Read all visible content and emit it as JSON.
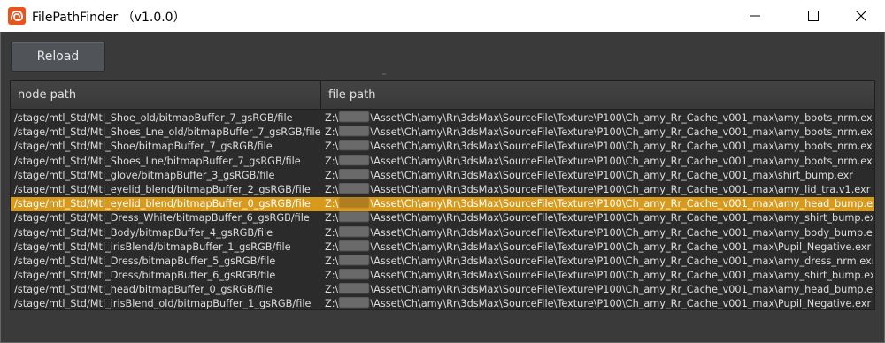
{
  "window": {
    "title": "FilePathFinder （v1.0.0）",
    "controls": {
      "minimize": "—",
      "maximize": "☐",
      "close": "✕"
    }
  },
  "toolbar": {
    "reload_label": "Reload"
  },
  "table": {
    "columns": [
      "node path",
      "file path"
    ],
    "selected_index": 6,
    "rows": [
      {
        "node": "/stage/mtl_Std/Mtl_Shoe_old/bitmapBuffer_7_gsRGB/file",
        "drive": "Z:\\",
        "file": "\\Asset\\Ch\\amy\\Rr\\3dsMax\\SourceFile\\Texture\\P100\\Ch_amy_Rr_Cache_v001_max\\amy_boots_nrm.exr"
      },
      {
        "node": "/stage/mtl_Std/Mtl_Shoes_Lne_old/bitmapBuffer_7_gsRGB/file",
        "drive": "Z:\\",
        "file": "\\Asset\\Ch\\amy\\Rr\\3dsMax\\SourceFile\\Texture\\P100\\Ch_amy_Rr_Cache_v001_max\\amy_boots_nrm.exr"
      },
      {
        "node": "/stage/mtl_Std/Mtl_Shoe/bitmapBuffer_7_gsRGB/file",
        "drive": "Z:\\",
        "file": "\\Asset\\Ch\\amy\\Rr\\3dsMax\\SourceFile\\Texture\\P100\\Ch_amy_Rr_Cache_v001_max\\amy_boots_nrm.exr"
      },
      {
        "node": "/stage/mtl_Std/Mtl_Shoes_Lne/bitmapBuffer_7_gsRGB/file",
        "drive": "Z:\\",
        "file": "\\Asset\\Ch\\amy\\Rr\\3dsMax\\SourceFile\\Texture\\P100\\Ch_amy_Rr_Cache_v001_max\\amy_boots_nrm.exr"
      },
      {
        "node": "/stage/mtl_Std/Mtl_glove/bitmapBuffer_3_gsRGB/file",
        "drive": "Z:\\",
        "file": "\\Asset\\Ch\\amy\\Rr\\3dsMax\\SourceFile\\Texture\\P100\\Ch_amy_Rr_Cache_v001_max\\shirt_bump.exr"
      },
      {
        "node": "/stage/mtl_Std/Mtl_eyelid_blend/bitmapBuffer_2_gsRGB/file",
        "drive": "Z:\\",
        "file": "\\Asset\\Ch\\amy\\Rr\\3dsMax\\SourceFile\\Texture\\P100\\Ch_amy_Rr_Cache_v001_max\\amy_lid_tra.v1.exr"
      },
      {
        "node": "/stage/mtl_Std/Mtl_eyelid_blend/bitmapBuffer_0_gsRGB/file",
        "drive": "Z:\\",
        "file": "\\Asset\\Ch\\amy\\Rr\\3dsMax\\SourceFile\\Texture\\P100\\Ch_amy_Rr_Cache_v001_max\\amy_head_bump.exr"
      },
      {
        "node": "/stage/mtl_Std/Mtl_Dress_White/bitmapBuffer_6_gsRGB/file",
        "drive": "Z:\\",
        "file": "\\Asset\\Ch\\amy\\Rr\\3dsMax\\SourceFile\\Texture\\P100\\Ch_amy_Rr_Cache_v001_max\\amy_shirt_bump.exr"
      },
      {
        "node": "/stage/mtl_Std/Mtl_Body/bitmapBuffer_4_gsRGB/file",
        "drive": "Z:\\",
        "file": "\\Asset\\Ch\\amy\\Rr\\3dsMax\\SourceFile\\Texture\\P100\\Ch_amy_Rr_Cache_v001_max\\amy_body_bump.exr"
      },
      {
        "node": "/stage/mtl_Std/Mtl_irisBlend/bitmapBuffer_1_gsRGB/file",
        "drive": "Z:\\",
        "file": "\\Asset\\Ch\\amy\\Rr\\3dsMax\\SourceFile\\Texture\\P100\\Ch_amy_Rr_Cache_v001_max\\Pupil_Negative.exr"
      },
      {
        "node": "/stage/mtl_Std/Mtl_Dress/bitmapBuffer_5_gsRGB/file",
        "drive": "Z:\\",
        "file": "\\Asset\\Ch\\amy\\Rr\\3dsMax\\SourceFile\\Texture\\P100\\Ch_amy_Rr_Cache_v001_max\\amy_dress_nrm.exr"
      },
      {
        "node": "/stage/mtl_Std/Mtl_Dress/bitmapBuffer_6_gsRGB/file",
        "drive": "Z:\\",
        "file": "\\Asset\\Ch\\amy\\Rr\\3dsMax\\SourceFile\\Texture\\P100\\Ch_amy_Rr_Cache_v001_max\\amy_shirt_bump.exr"
      },
      {
        "node": "/stage/mtl_Std/Mtl_head/bitmapBuffer_0_gsRGB/file",
        "drive": "Z:\\",
        "file": "\\Asset\\Ch\\amy\\Rr\\3dsMax\\SourceFile\\Texture\\P100\\Ch_amy_Rr_Cache_v001_max\\amy_head_bump.exr"
      },
      {
        "node": "/stage/mtl_Std/Mtl_irisBlend_old/bitmapBuffer_1_gsRGB/file",
        "drive": "Z:\\",
        "file": "\\Asset\\Ch\\amy\\Rr\\3dsMax\\SourceFile\\Texture\\P100\\Ch_amy_Rr_Cache_v001_max\\Pupil_Negative.exr"
      }
    ]
  },
  "colors": {
    "selection": "#d89a1c",
    "background": "#3a3a3a",
    "table_bg": "#2b2b2b",
    "app_icon": "#e8541c"
  },
  "icons": {
    "app": "houdini-logo-icon",
    "minimize": "minimize-icon",
    "maximize": "maximize-icon",
    "close": "close-icon"
  }
}
